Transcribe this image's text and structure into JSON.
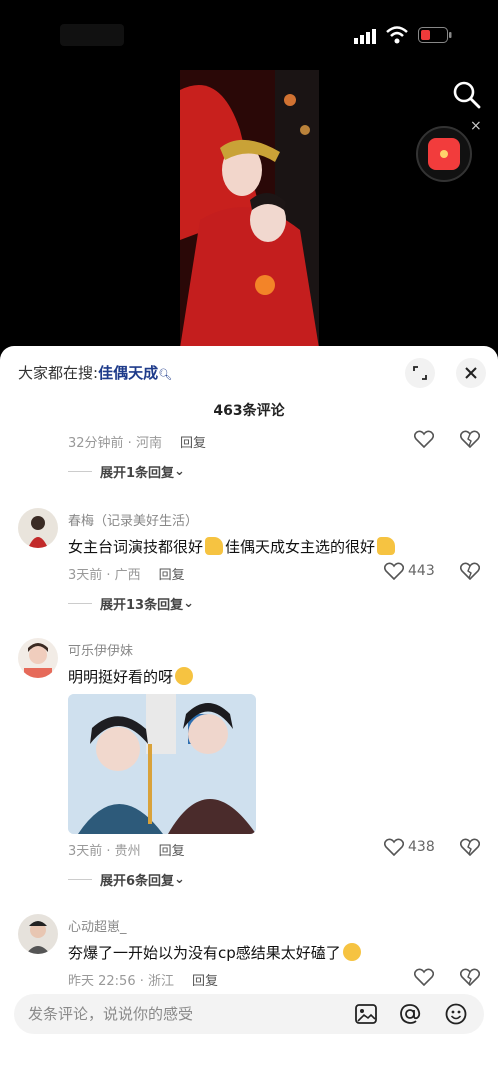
{
  "panel": {
    "search_prefix": "大家都在搜:",
    "search_keyword": "佳偶天成",
    "comment_count": "463条评论"
  },
  "comments": [
    {
      "time_location": "32分钟前 · 河南",
      "reply_label": "回复",
      "expand_label": "展开1条回复"
    },
    {
      "username": "春梅（记录美好生活）",
      "text_a": "女主台词演技都很好",
      "text_b": "佳偶天成女主选的很好",
      "time_location": "3天前 · 广西",
      "reply_label": "回复",
      "likes": "443",
      "expand_label": "展开13条回复"
    },
    {
      "username": "可乐伊伊妹",
      "text": "明明挺好看的呀",
      "time_location": "3天前 · 贵州",
      "reply_label": "回复",
      "likes": "438",
      "expand_label": "展开6条回复"
    },
    {
      "username": "心动超崽_",
      "text": "夯爆了一开始以为没有cp感结果太好磕了",
      "time_location": "昨天 22:56 · 浙江",
      "reply_label": "回复"
    }
  ],
  "input": {
    "placeholder": "发条评论，说说你的感受"
  },
  "icons": {
    "search": "search-icon",
    "red_packet": "red-packet-icon",
    "expand": "expand-icon",
    "close": "close-icon",
    "like": "heart-icon",
    "dislike": "broken-heart-icon",
    "image": "image-icon",
    "mention": "at-icon",
    "emoji": "emoji-icon"
  },
  "colors": {
    "keyword": "#1e3b8a",
    "video_red": "#c41e1e"
  }
}
